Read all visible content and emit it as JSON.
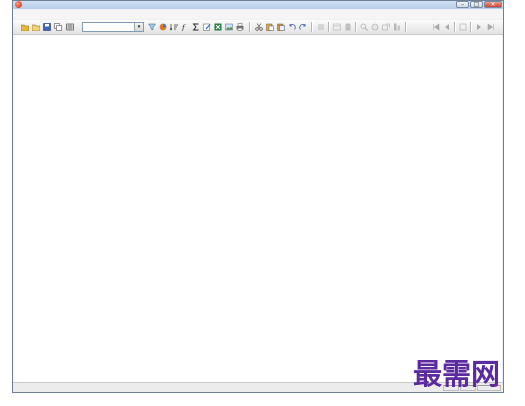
{
  "window": {
    "app_title": "",
    "date_text": "",
    "weekday_text": ""
  },
  "window_controls": {
    "minimize": "–",
    "maximize": "□",
    "close": "×"
  },
  "menus": [
    "",
    "",
    "",
    "",
    "",
    "",
    "",
    ""
  ],
  "toolbar": {
    "combo_value": "",
    "combo_arrow": "▾"
  },
  "watermark": "最需网"
}
